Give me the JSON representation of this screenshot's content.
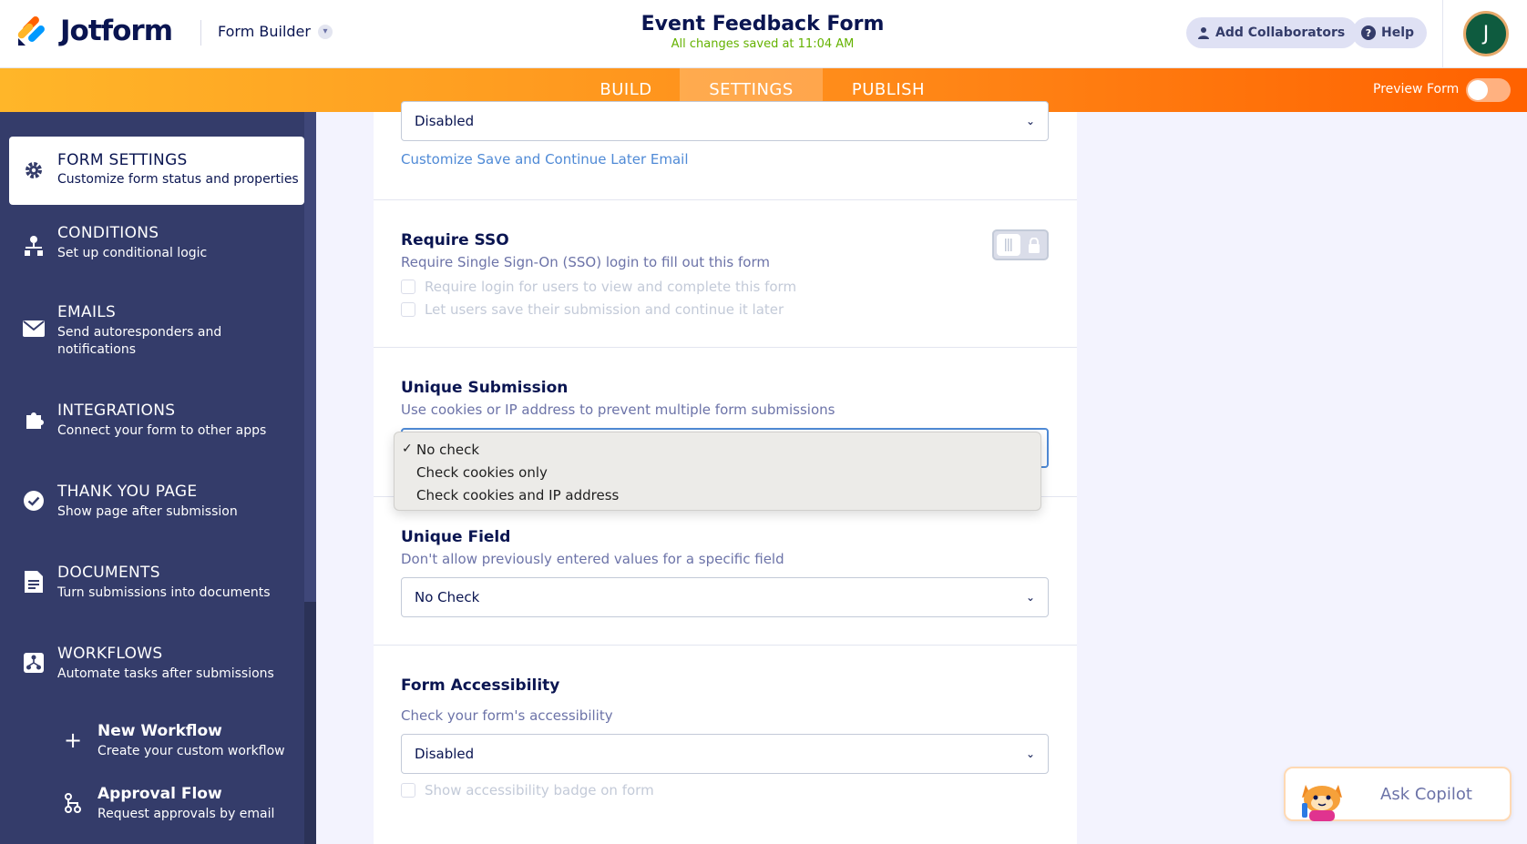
{
  "header": {
    "logo_text": "Jotform",
    "builder_label": "Form Builder",
    "form_title": "Event Feedback Form",
    "saved_status": "All changes saved at 11:04 AM",
    "collaborators_label": "Add Collaborators",
    "help_label": "Help",
    "avatar_initial": "J"
  },
  "tabs": [
    {
      "label": "BUILD",
      "active": false
    },
    {
      "label": "SETTINGS",
      "active": true
    },
    {
      "label": "PUBLISH",
      "active": false
    }
  ],
  "preview": {
    "label": "Preview Form",
    "on": false
  },
  "sidebar": {
    "items": [
      {
        "title": "FORM SETTINGS",
        "desc": "Customize form status and properties",
        "icon": "gear-icon",
        "active": true
      },
      {
        "title": "CONDITIONS",
        "desc": "Set up conditional logic",
        "icon": "conditions-icon",
        "active": false
      },
      {
        "title": "EMAILS",
        "desc": "Send autoresponders and",
        "desc2": "notifications",
        "icon": "envelope-icon",
        "active": false
      },
      {
        "title": "INTEGRATIONS",
        "desc": "Connect your form to other apps",
        "icon": "puzzle-icon",
        "active": false
      },
      {
        "title": "THANK YOU PAGE",
        "desc": "Show page after submission",
        "icon": "check-circle-icon",
        "active": false
      },
      {
        "title": "DOCUMENTS",
        "desc": "Turn submissions into documents",
        "icon": "document-icon",
        "active": false
      },
      {
        "title": "WORKFLOWS",
        "desc": "Automate tasks after submissions",
        "icon": "workflow-icon",
        "active": false
      }
    ],
    "subitems": [
      {
        "title": "New Workflow",
        "desc": "Create your custom workflow",
        "icon": "plus-icon"
      },
      {
        "title": "Approval Flow",
        "desc": "Request approvals by email",
        "icon": "approval-icon"
      }
    ]
  },
  "content": {
    "save_continue": {
      "value": "Disabled",
      "link": "Customize Save and Continue Later Email"
    },
    "require_sso": {
      "title": "Require SSO",
      "desc": "Require Single Sign-On (SSO) login to fill out this form",
      "options": [
        "Require login for users to view and complete this form",
        "Let users save their submission and continue it later"
      ]
    },
    "unique_submission": {
      "title": "Unique Submission",
      "desc": "Use cookies or IP address to prevent multiple form submissions",
      "dropdown_options": [
        {
          "label": "No check",
          "selected": true
        },
        {
          "label": "Check cookies only",
          "selected": false
        },
        {
          "label": "Check cookies and IP address",
          "selected": false
        }
      ],
      "check_mark": "✓"
    },
    "unique_field": {
      "title": "Unique Field",
      "desc": "Don't allow previously entered values for a specific field",
      "value": "No Check"
    },
    "accessibility": {
      "title": "Form Accessibility",
      "desc": "Check your form's accessibility",
      "value": "Disabled",
      "badge_option": "Show accessibility badge on form"
    }
  },
  "copilot": {
    "label": "Ask Copilot"
  },
  "colors": {
    "brand_orange": "#ff6100",
    "sidebar_bg": "#343c6a",
    "navy_text": "#0a1551",
    "saved_green": "#64b200",
    "link_blue": "#4f8ad6"
  }
}
